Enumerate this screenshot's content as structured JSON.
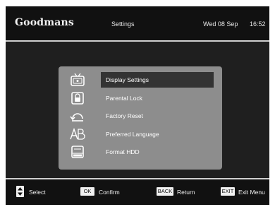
{
  "header": {
    "brand": "Goodmans",
    "title": "Settings",
    "date": "Wed 08 Sep",
    "time": "16:52"
  },
  "menu": {
    "items": [
      {
        "label": "Display Settings",
        "icon": "tv-icon",
        "selected": true
      },
      {
        "label": "Parental Lock",
        "icon": "lock-icon",
        "selected": false
      },
      {
        "label": "Factory Reset",
        "icon": "reset-icon",
        "selected": false
      },
      {
        "label": "Preferred Language",
        "icon": "language-icon",
        "selected": false
      },
      {
        "label": "Format HDD",
        "icon": "hdd-icon",
        "selected": false
      }
    ]
  },
  "footer": {
    "select_label": "Select",
    "ok_key": "OK",
    "confirm_label": "Confirm",
    "back_key": "BACK",
    "return_label": "Return",
    "exit_key": "EXIT",
    "exit_label": "Exit Menu"
  },
  "colors": {
    "screen_bg": "#1a1a1a",
    "menu_bg": "#8d8d8d",
    "selection": "#333333",
    "text": "#ffffff"
  }
}
